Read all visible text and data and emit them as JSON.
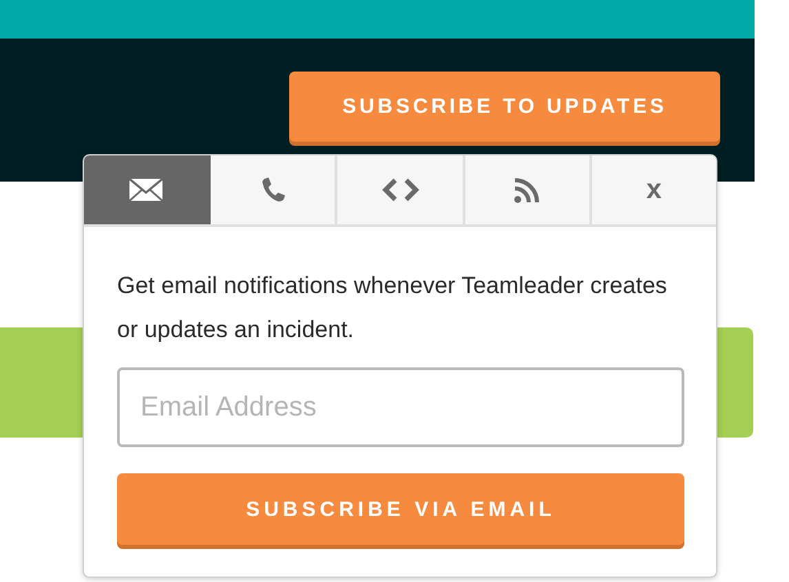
{
  "header": {
    "subscribe_button": "SUBSCRIBE TO UPDATES"
  },
  "popup": {
    "tabs": [
      {
        "kind": "email",
        "selected": true
      },
      {
        "kind": "phone",
        "selected": false
      },
      {
        "kind": "code",
        "selected": false
      },
      {
        "kind": "rss",
        "selected": false
      },
      {
        "kind": "close",
        "label": "x",
        "selected": false
      }
    ],
    "description": "Get email notifications whenever Teamleader creates or updates an incident.",
    "email_field": {
      "placeholder": "Email Address"
    },
    "submit_button": "SUBSCRIBE VIA EMAIL"
  }
}
